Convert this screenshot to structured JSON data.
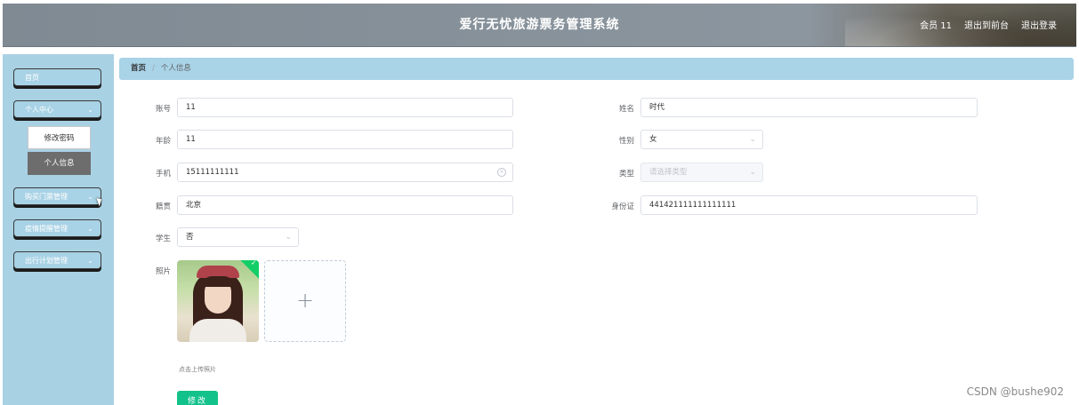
{
  "header": {
    "title": "爱行无忧旅游票务管理系统",
    "user": "会员 11",
    "back_label": "退出到前台",
    "logout_label": "退出登录"
  },
  "sidebar": {
    "items": [
      {
        "label": "首页"
      },
      {
        "label": "个人中心"
      },
      {
        "label": "购买门票管理"
      },
      {
        "label": "疫情提醒管理"
      },
      {
        "label": "出行计划管理"
      }
    ],
    "submenu": [
      {
        "label": "修改密码"
      },
      {
        "label": "个人信息"
      }
    ]
  },
  "breadcrumb": {
    "home": "首页",
    "separator": "/",
    "current": "个人信息"
  },
  "form": {
    "account": {
      "label": "账号",
      "value": "11"
    },
    "name": {
      "label": "姓名",
      "value": "时代"
    },
    "age": {
      "label": "年龄",
      "value": "11"
    },
    "gender": {
      "label": "性别",
      "value": "女"
    },
    "phone": {
      "label": "手机",
      "value": "15111111111"
    },
    "type": {
      "label": "类型",
      "placeholder": "请选择类型"
    },
    "origin": {
      "label": "籍贯",
      "value": "北京"
    },
    "idcard": {
      "label": "身份证",
      "value": "441421111111111111"
    },
    "student": {
      "label": "学生",
      "value": "否"
    },
    "photo": {
      "label": "照片",
      "tip": "点击上传照片",
      "add_symbol": "+"
    },
    "submit_label": "修改"
  },
  "watermark": "CSDN @bushe902",
  "colors": {
    "sidebar_bg": "#a9d1e4",
    "breadcrumb_bg": "#a9d3e6",
    "submit_bg": "#13c28a",
    "active_submenu": "#6d6d6d"
  }
}
